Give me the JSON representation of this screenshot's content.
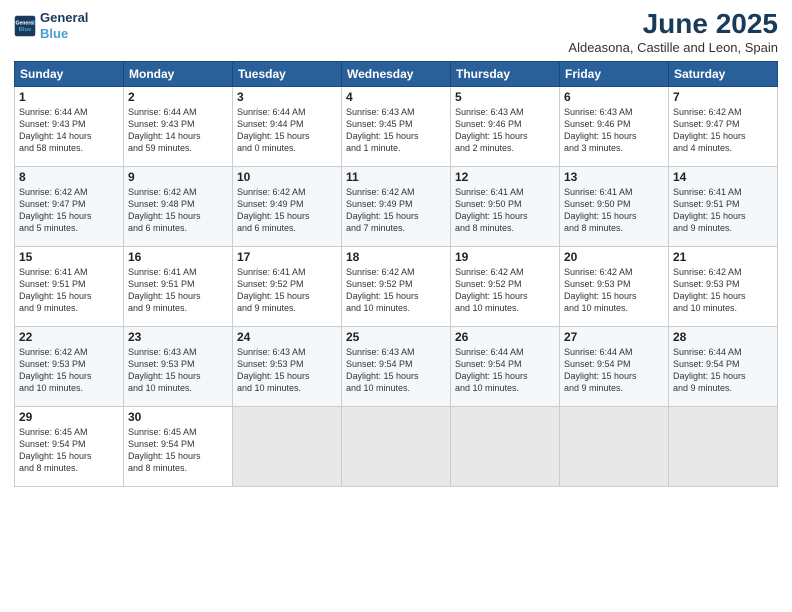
{
  "header": {
    "logo_line1": "General",
    "logo_line2": "Blue",
    "month_title": "June 2025",
    "location": "Aldeasona, Castille and Leon, Spain"
  },
  "columns": [
    "Sunday",
    "Monday",
    "Tuesday",
    "Wednesday",
    "Thursday",
    "Friday",
    "Saturday"
  ],
  "weeks": [
    [
      {
        "day": "1",
        "lines": [
          "Sunrise: 6:44 AM",
          "Sunset: 9:43 PM",
          "Daylight: 14 hours",
          "and 58 minutes."
        ]
      },
      {
        "day": "2",
        "lines": [
          "Sunrise: 6:44 AM",
          "Sunset: 9:43 PM",
          "Daylight: 14 hours",
          "and 59 minutes."
        ]
      },
      {
        "day": "3",
        "lines": [
          "Sunrise: 6:44 AM",
          "Sunset: 9:44 PM",
          "Daylight: 15 hours",
          "and 0 minutes."
        ]
      },
      {
        "day": "4",
        "lines": [
          "Sunrise: 6:43 AM",
          "Sunset: 9:45 PM",
          "Daylight: 15 hours",
          "and 1 minute."
        ]
      },
      {
        "day": "5",
        "lines": [
          "Sunrise: 6:43 AM",
          "Sunset: 9:46 PM",
          "Daylight: 15 hours",
          "and 2 minutes."
        ]
      },
      {
        "day": "6",
        "lines": [
          "Sunrise: 6:43 AM",
          "Sunset: 9:46 PM",
          "Daylight: 15 hours",
          "and 3 minutes."
        ]
      },
      {
        "day": "7",
        "lines": [
          "Sunrise: 6:42 AM",
          "Sunset: 9:47 PM",
          "Daylight: 15 hours",
          "and 4 minutes."
        ]
      }
    ],
    [
      {
        "day": "8",
        "lines": [
          "Sunrise: 6:42 AM",
          "Sunset: 9:47 PM",
          "Daylight: 15 hours",
          "and 5 minutes."
        ]
      },
      {
        "day": "9",
        "lines": [
          "Sunrise: 6:42 AM",
          "Sunset: 9:48 PM",
          "Daylight: 15 hours",
          "and 6 minutes."
        ]
      },
      {
        "day": "10",
        "lines": [
          "Sunrise: 6:42 AM",
          "Sunset: 9:49 PM",
          "Daylight: 15 hours",
          "and 6 minutes."
        ]
      },
      {
        "day": "11",
        "lines": [
          "Sunrise: 6:42 AM",
          "Sunset: 9:49 PM",
          "Daylight: 15 hours",
          "and 7 minutes."
        ]
      },
      {
        "day": "12",
        "lines": [
          "Sunrise: 6:41 AM",
          "Sunset: 9:50 PM",
          "Daylight: 15 hours",
          "and 8 minutes."
        ]
      },
      {
        "day": "13",
        "lines": [
          "Sunrise: 6:41 AM",
          "Sunset: 9:50 PM",
          "Daylight: 15 hours",
          "and 8 minutes."
        ]
      },
      {
        "day": "14",
        "lines": [
          "Sunrise: 6:41 AM",
          "Sunset: 9:51 PM",
          "Daylight: 15 hours",
          "and 9 minutes."
        ]
      }
    ],
    [
      {
        "day": "15",
        "lines": [
          "Sunrise: 6:41 AM",
          "Sunset: 9:51 PM",
          "Daylight: 15 hours",
          "and 9 minutes."
        ]
      },
      {
        "day": "16",
        "lines": [
          "Sunrise: 6:41 AM",
          "Sunset: 9:51 PM",
          "Daylight: 15 hours",
          "and 9 minutes."
        ]
      },
      {
        "day": "17",
        "lines": [
          "Sunrise: 6:41 AM",
          "Sunset: 9:52 PM",
          "Daylight: 15 hours",
          "and 9 minutes."
        ]
      },
      {
        "day": "18",
        "lines": [
          "Sunrise: 6:42 AM",
          "Sunset: 9:52 PM",
          "Daylight: 15 hours",
          "and 10 minutes."
        ]
      },
      {
        "day": "19",
        "lines": [
          "Sunrise: 6:42 AM",
          "Sunset: 9:52 PM",
          "Daylight: 15 hours",
          "and 10 minutes."
        ]
      },
      {
        "day": "20",
        "lines": [
          "Sunrise: 6:42 AM",
          "Sunset: 9:53 PM",
          "Daylight: 15 hours",
          "and 10 minutes."
        ]
      },
      {
        "day": "21",
        "lines": [
          "Sunrise: 6:42 AM",
          "Sunset: 9:53 PM",
          "Daylight: 15 hours",
          "and 10 minutes."
        ]
      }
    ],
    [
      {
        "day": "22",
        "lines": [
          "Sunrise: 6:42 AM",
          "Sunset: 9:53 PM",
          "Daylight: 15 hours",
          "and 10 minutes."
        ]
      },
      {
        "day": "23",
        "lines": [
          "Sunrise: 6:43 AM",
          "Sunset: 9:53 PM",
          "Daylight: 15 hours",
          "and 10 minutes."
        ]
      },
      {
        "day": "24",
        "lines": [
          "Sunrise: 6:43 AM",
          "Sunset: 9:53 PM",
          "Daylight: 15 hours",
          "and 10 minutes."
        ]
      },
      {
        "day": "25",
        "lines": [
          "Sunrise: 6:43 AM",
          "Sunset: 9:54 PM",
          "Daylight: 15 hours",
          "and 10 minutes."
        ]
      },
      {
        "day": "26",
        "lines": [
          "Sunrise: 6:44 AM",
          "Sunset: 9:54 PM",
          "Daylight: 15 hours",
          "and 10 minutes."
        ]
      },
      {
        "day": "27",
        "lines": [
          "Sunrise: 6:44 AM",
          "Sunset: 9:54 PM",
          "Daylight: 15 hours",
          "and 9 minutes."
        ]
      },
      {
        "day": "28",
        "lines": [
          "Sunrise: 6:44 AM",
          "Sunset: 9:54 PM",
          "Daylight: 15 hours",
          "and 9 minutes."
        ]
      }
    ],
    [
      {
        "day": "29",
        "lines": [
          "Sunrise: 6:45 AM",
          "Sunset: 9:54 PM",
          "Daylight: 15 hours",
          "and 8 minutes."
        ]
      },
      {
        "day": "30",
        "lines": [
          "Sunrise: 6:45 AM",
          "Sunset: 9:54 PM",
          "Daylight: 15 hours",
          "and 8 minutes."
        ]
      },
      {
        "day": "",
        "lines": []
      },
      {
        "day": "",
        "lines": []
      },
      {
        "day": "",
        "lines": []
      },
      {
        "day": "",
        "lines": []
      },
      {
        "day": "",
        "lines": []
      }
    ]
  ]
}
